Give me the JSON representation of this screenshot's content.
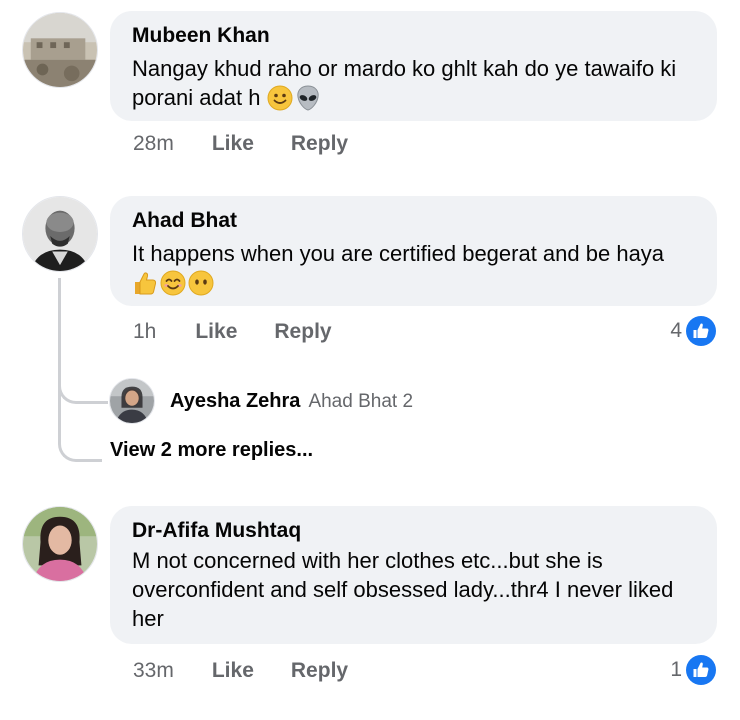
{
  "comments": [
    {
      "author": "Mubeen Khan",
      "text": "Nangay khud raho or mardo ko ghlt kah do ye tawaifo ki porani adat h",
      "emojis": [
        "slightly-smiling-face",
        "alien"
      ],
      "time": "28m",
      "like_label": "Like",
      "reply_label": "Reply"
    },
    {
      "author": "Ahad Bhat",
      "text": "It happens when you are certified begerat and be haya",
      "emojis": [
        "thumbs-up",
        "smiling-face",
        "no-mouth-face"
      ],
      "time": "1h",
      "like_label": "Like",
      "reply_label": "Reply",
      "reaction_count": "4",
      "reply_preview": {
        "author": "Ayesha Zehra",
        "snippet": "Ahad Bhat 2"
      },
      "view_more_label": "View 2 more replies..."
    },
    {
      "author": "Dr-Afifa Mushtaq",
      "text_lines": [
        "M not concerned with her clothes etc...but she is",
        "overconfident and self obsessed lady...thr4 I never liked",
        "her"
      ],
      "time": "33m",
      "like_label": "Like",
      "reply_label": "Reply",
      "reaction_count": "1"
    }
  ],
  "colors": {
    "bubble": "#f0f2f5",
    "secondary_text": "#65676b",
    "like_blue": "#1877f2",
    "thread_line": "#ced0d4"
  }
}
